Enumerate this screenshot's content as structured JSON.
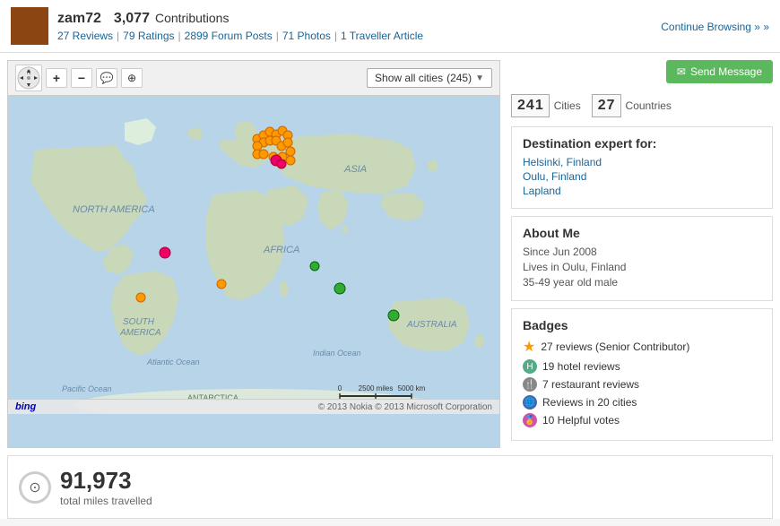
{
  "header": {
    "username": "zam72",
    "contributions_count": "3,077",
    "contributions_label": "Contributions",
    "stats": [
      {
        "label": "27 Reviews",
        "href": "#"
      },
      {
        "label": "79 Ratings",
        "href": "#"
      },
      {
        "label": "2899 Forum Posts",
        "href": "#"
      },
      {
        "label": "71 Photos",
        "href": "#"
      },
      {
        "label": "1 Traveller Article",
        "href": "#"
      }
    ],
    "continue_browsing": "Continue Browsing »"
  },
  "map": {
    "show_cities_label": "Show all cities",
    "show_cities_count": "(245)",
    "nav_label": "N",
    "copyright": "© 2013 Nokia   © 2013 Microsoft Corporation",
    "bing_label": "bing",
    "scale_miles": "2500 miles",
    "scale_km": "5000 km"
  },
  "stats": {
    "cities_digits": [
      "2",
      "4",
      "1"
    ],
    "cities_label": "Cities",
    "countries_digits": [
      "2",
      "7"
    ],
    "countries_label": "Countries"
  },
  "destination_expert": {
    "title": "Destination expert for:",
    "places": [
      {
        "label": "Helsinki, Finland",
        "href": "#"
      },
      {
        "label": "Oulu, Finland",
        "href": "#"
      },
      {
        "label": "Lapland",
        "href": "#"
      }
    ]
  },
  "about_me": {
    "title": "About Me",
    "since": "Since Jun 2008",
    "lives": "Lives in Oulu, Finland",
    "age": "35-49 year old male"
  },
  "badges": {
    "title": "Badges",
    "items": [
      {
        "icon": "star",
        "text": "27 reviews (Senior Contributor)"
      },
      {
        "icon": "hotel",
        "text": "19 hotel reviews"
      },
      {
        "icon": "restaurant",
        "text": "7 restaurant reviews"
      },
      {
        "icon": "city",
        "text": "Reviews in 20 cities"
      },
      {
        "icon": "ribbon",
        "text": "10 Helpful votes"
      }
    ]
  },
  "miles": {
    "number": "91,973",
    "label": "total miles travelled"
  },
  "send_message": "Send Message"
}
